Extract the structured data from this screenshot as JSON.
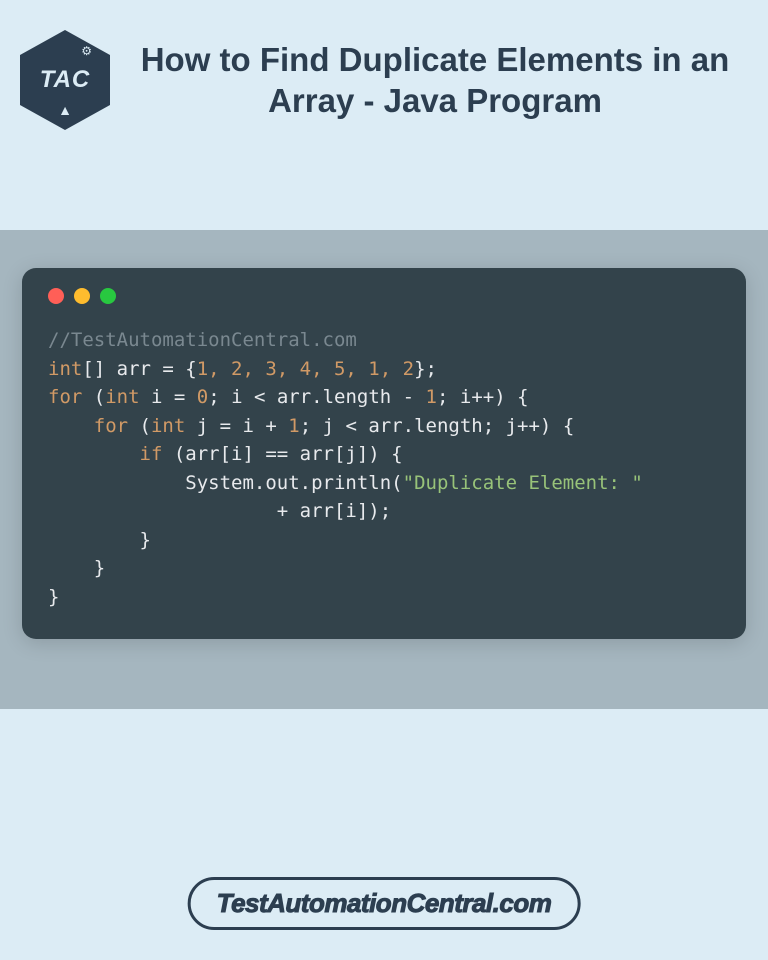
{
  "logo": {
    "text": "TAC"
  },
  "title": "How to Find Duplicate Elements in an Array - Java Program",
  "code": {
    "comment": "//TestAutomationCentral.com",
    "line1_type": "int",
    "line1_rest_a": "[] arr = {",
    "line1_nums": "1, 2, 3, 4, 5, 1, 2",
    "line1_rest_b": "};",
    "line2_kw": "for",
    "line2_a": " (",
    "line2_type": "int",
    "line2_b": " i = ",
    "line2_zero": "0",
    "line2_c": "; i < arr.length - ",
    "line2_one": "1",
    "line2_d": "; i++) {",
    "line3_indent": "    ",
    "line3_kw": "for",
    "line3_a": " (",
    "line3_type": "int",
    "line3_b": " j = i + ",
    "line3_one": "1",
    "line3_c": "; j < arr.length; j++) {",
    "line4_indent": "        ",
    "line4_kw": "if",
    "line4_a": " (arr[i] == arr[j]) {",
    "line5_indent": "            ",
    "line5_a": "System.out.println(",
    "line5_str": "\"Duplicate Element: \"",
    "line6_indent": "                    ",
    "line6_a": "+ arr[i]);",
    "line7": "        }",
    "line8": "    }",
    "line9": "}"
  },
  "footer": "TestAutomationCentral.com"
}
